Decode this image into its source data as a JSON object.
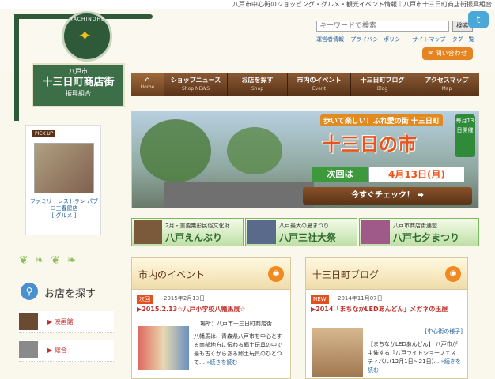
{
  "tagline": "八戸市中心街のショッピング・グルメ・観光イベント情報｜八戸市十三日町商店街振興組合",
  "logo": {
    "emblem_text": "HACHINOHE",
    "city": "八戸市",
    "name": "十三日町商店街",
    "sub": "振興組合"
  },
  "search": {
    "placeholder": "キーワードで検索",
    "button": "検索"
  },
  "header_links": [
    "運営者情報",
    "プライバシーポリシー",
    "サイトマップ",
    "タグ一覧"
  ],
  "contact_label": "問い合わせ",
  "nav": [
    {
      "jp": "",
      "en": "Home"
    },
    {
      "jp": "ショップニュース",
      "en": "Shop NEWS"
    },
    {
      "jp": "お店を探す",
      "en": "Shop"
    },
    {
      "jp": "市内のイベント",
      "en": "Event"
    },
    {
      "jp": "十三日町ブログ",
      "en": "Blog"
    },
    {
      "jp": "アクセスマップ",
      "en": "Map"
    }
  ],
  "pickup": {
    "label": "PICK UP",
    "name": "ファミリーレストラン パブロ三春屋店",
    "category": "[ グルメ ]"
  },
  "shop_search": {
    "title": "お店を探す",
    "items": [
      "映画館",
      "総合"
    ]
  },
  "banner": {
    "tag": "歩いて楽しい！ふれ愛の街 十三日町",
    "main": "十三日の市",
    "badge": "毎月13日開催",
    "next_label": "次回は",
    "next_date": "4月13日(月)",
    "check": "今すぐチェック！ ➡"
  },
  "features": [
    {
      "small": "2月・重要無形民俗文化財",
      "big": "八戸えんぶり"
    },
    {
      "small": "八戸最大の夏まつり",
      "big": "八戸三社大祭"
    },
    {
      "small": "八戸市商店街連盟",
      "big": "八戸七夕まつり"
    }
  ],
  "events": {
    "title": "市内のイベント",
    "badge": "次回",
    "date": "2015年2月13日",
    "item_title": "▶2015.2.13☆八戸小学校八幡馬展☆",
    "place": "場所：八戸市十三日町商店街",
    "text": "八幡馬は、青森県八戸市を中心とする南部地方に伝わる郷土玩具の中で最も古くからある郷土玩具のひとつで…",
    "more": "»続きを読む"
  },
  "blog": {
    "title": "十三日町ブログ",
    "badge": "NEW",
    "date": "2014年11月07日",
    "item_title": "▶2014「まちなかLEDあんどん」メガネの玉屋",
    "category": "[中心街の様子]",
    "text": "【まちなかLEDあんどん】 八戸市が主催する『八戸ライトショーフェスティバル(12月1日～21日)…",
    "more": "»続きを読む"
  }
}
